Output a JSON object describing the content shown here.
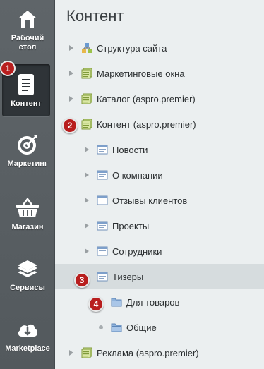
{
  "sidebar": {
    "items": [
      {
        "label": "Рабочий стол",
        "icon": "home-icon"
      },
      {
        "label": "Контент",
        "icon": "document-icon"
      },
      {
        "label": "Маркетинг",
        "icon": "target-icon"
      },
      {
        "label": "Магазин",
        "icon": "basket-icon"
      },
      {
        "label": "Сервисы",
        "icon": "layers-icon"
      },
      {
        "label": "Marketplace",
        "icon": "cloud-download-icon"
      }
    ]
  },
  "panel": {
    "title": "Контент",
    "tree": [
      {
        "label": "Структура сайта",
        "icon": "site-structure-icon"
      },
      {
        "label": "Маркетинговые окна",
        "icon": "iblock-type-icon"
      },
      {
        "label": "Каталог (aspro.premier)",
        "icon": "iblock-type-icon"
      },
      {
        "label": "Контент (aspro.premier)",
        "icon": "iblock-type-icon"
      },
      {
        "label": "Новости",
        "icon": "iblock-icon"
      },
      {
        "label": "О компании",
        "icon": "iblock-icon"
      },
      {
        "label": "Отзывы клиентов",
        "icon": "iblock-icon"
      },
      {
        "label": "Проекты",
        "icon": "iblock-icon"
      },
      {
        "label": "Сотрудники",
        "icon": "iblock-icon"
      },
      {
        "label": "Тизеры",
        "icon": "iblock-icon"
      },
      {
        "label": "Для товаров",
        "icon": "folder-icon"
      },
      {
        "label": "Общие",
        "icon": "folder-icon"
      },
      {
        "label": "Реклама (aspro.premier)",
        "icon": "iblock-type-icon"
      }
    ]
  },
  "badges": [
    "1",
    "2",
    "3",
    "4"
  ],
  "colors": {
    "sidebar": "#585e62",
    "badge": "#b81e1e",
    "selected_row": "#d6dcde",
    "panel_bg": "#ebeff0"
  }
}
